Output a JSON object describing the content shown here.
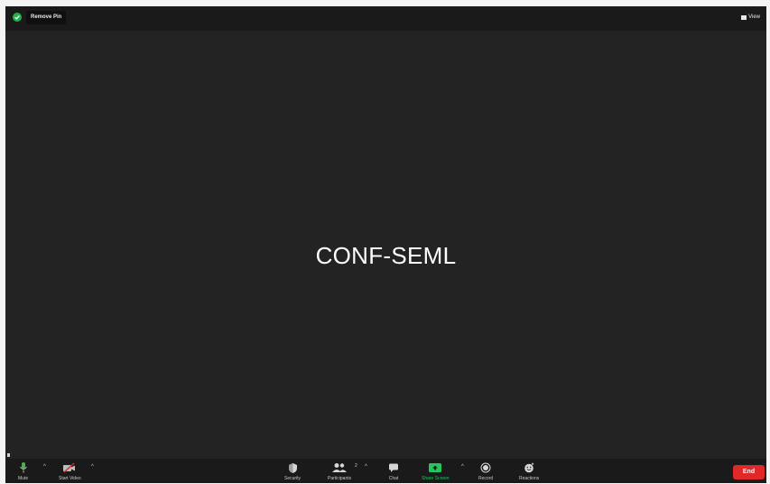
{
  "topbar": {
    "remove_pin_label": "Remove Pin",
    "view_label": "View"
  },
  "stage": {
    "participant_name": "CONF-SEML"
  },
  "toolbar": {
    "mute_label": "Mute",
    "start_video_label": "Start Video",
    "security_label": "Security",
    "participants_label": "Participants",
    "participants_count": "2",
    "chat_label": "Chat",
    "share_screen_label": "Share Screen",
    "record_label": "Record",
    "reactions_label": "Reactions",
    "end_label": "End"
  },
  "colors": {
    "accent_green": "#22b14c",
    "share_green": "#22c55e",
    "end_red": "#e02828",
    "background": "#232323"
  },
  "icons": {
    "shield": "shield-check-icon",
    "view": "grid-view-icon",
    "mute": "microphone-icon",
    "start_video": "video-off-icon",
    "security": "shield-icon",
    "participants": "people-icon",
    "chat": "chat-bubble-icon",
    "share_screen": "share-screen-icon",
    "record": "record-icon",
    "reactions": "smiley-icon"
  }
}
